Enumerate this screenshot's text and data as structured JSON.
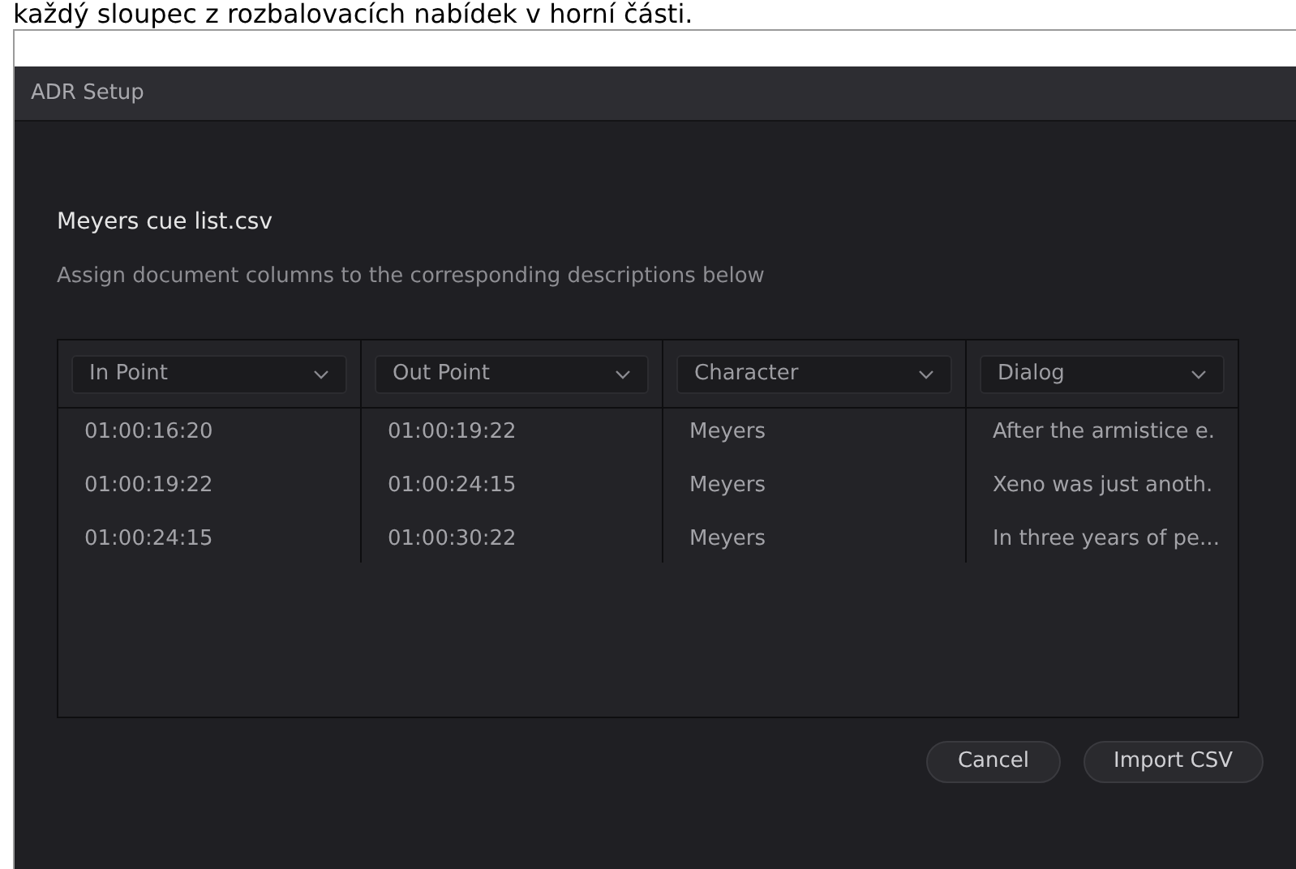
{
  "caption": "každý sloupec z rozbalovacích nabídek v horní části.",
  "window": {
    "title": "ADR Setup"
  },
  "file_name": "Meyers cue list.csv",
  "instructions": "Assign document columns to the corresponding descriptions below",
  "table": {
    "columns": [
      "In Point",
      "Out Point",
      "Character",
      "Dialog"
    ],
    "rows": [
      [
        "01:00:16:20",
        "01:00:19:22",
        "Meyers",
        "After the armistice e."
      ],
      [
        "01:00:19:22",
        "01:00:24:15",
        "Meyers",
        "Xeno was just anoth."
      ],
      [
        "01:00:24:15",
        "01:00:30:22",
        "Meyers",
        "In three years of pe..."
      ]
    ]
  },
  "buttons": [
    "Cancel",
    "Import CSV"
  ]
}
